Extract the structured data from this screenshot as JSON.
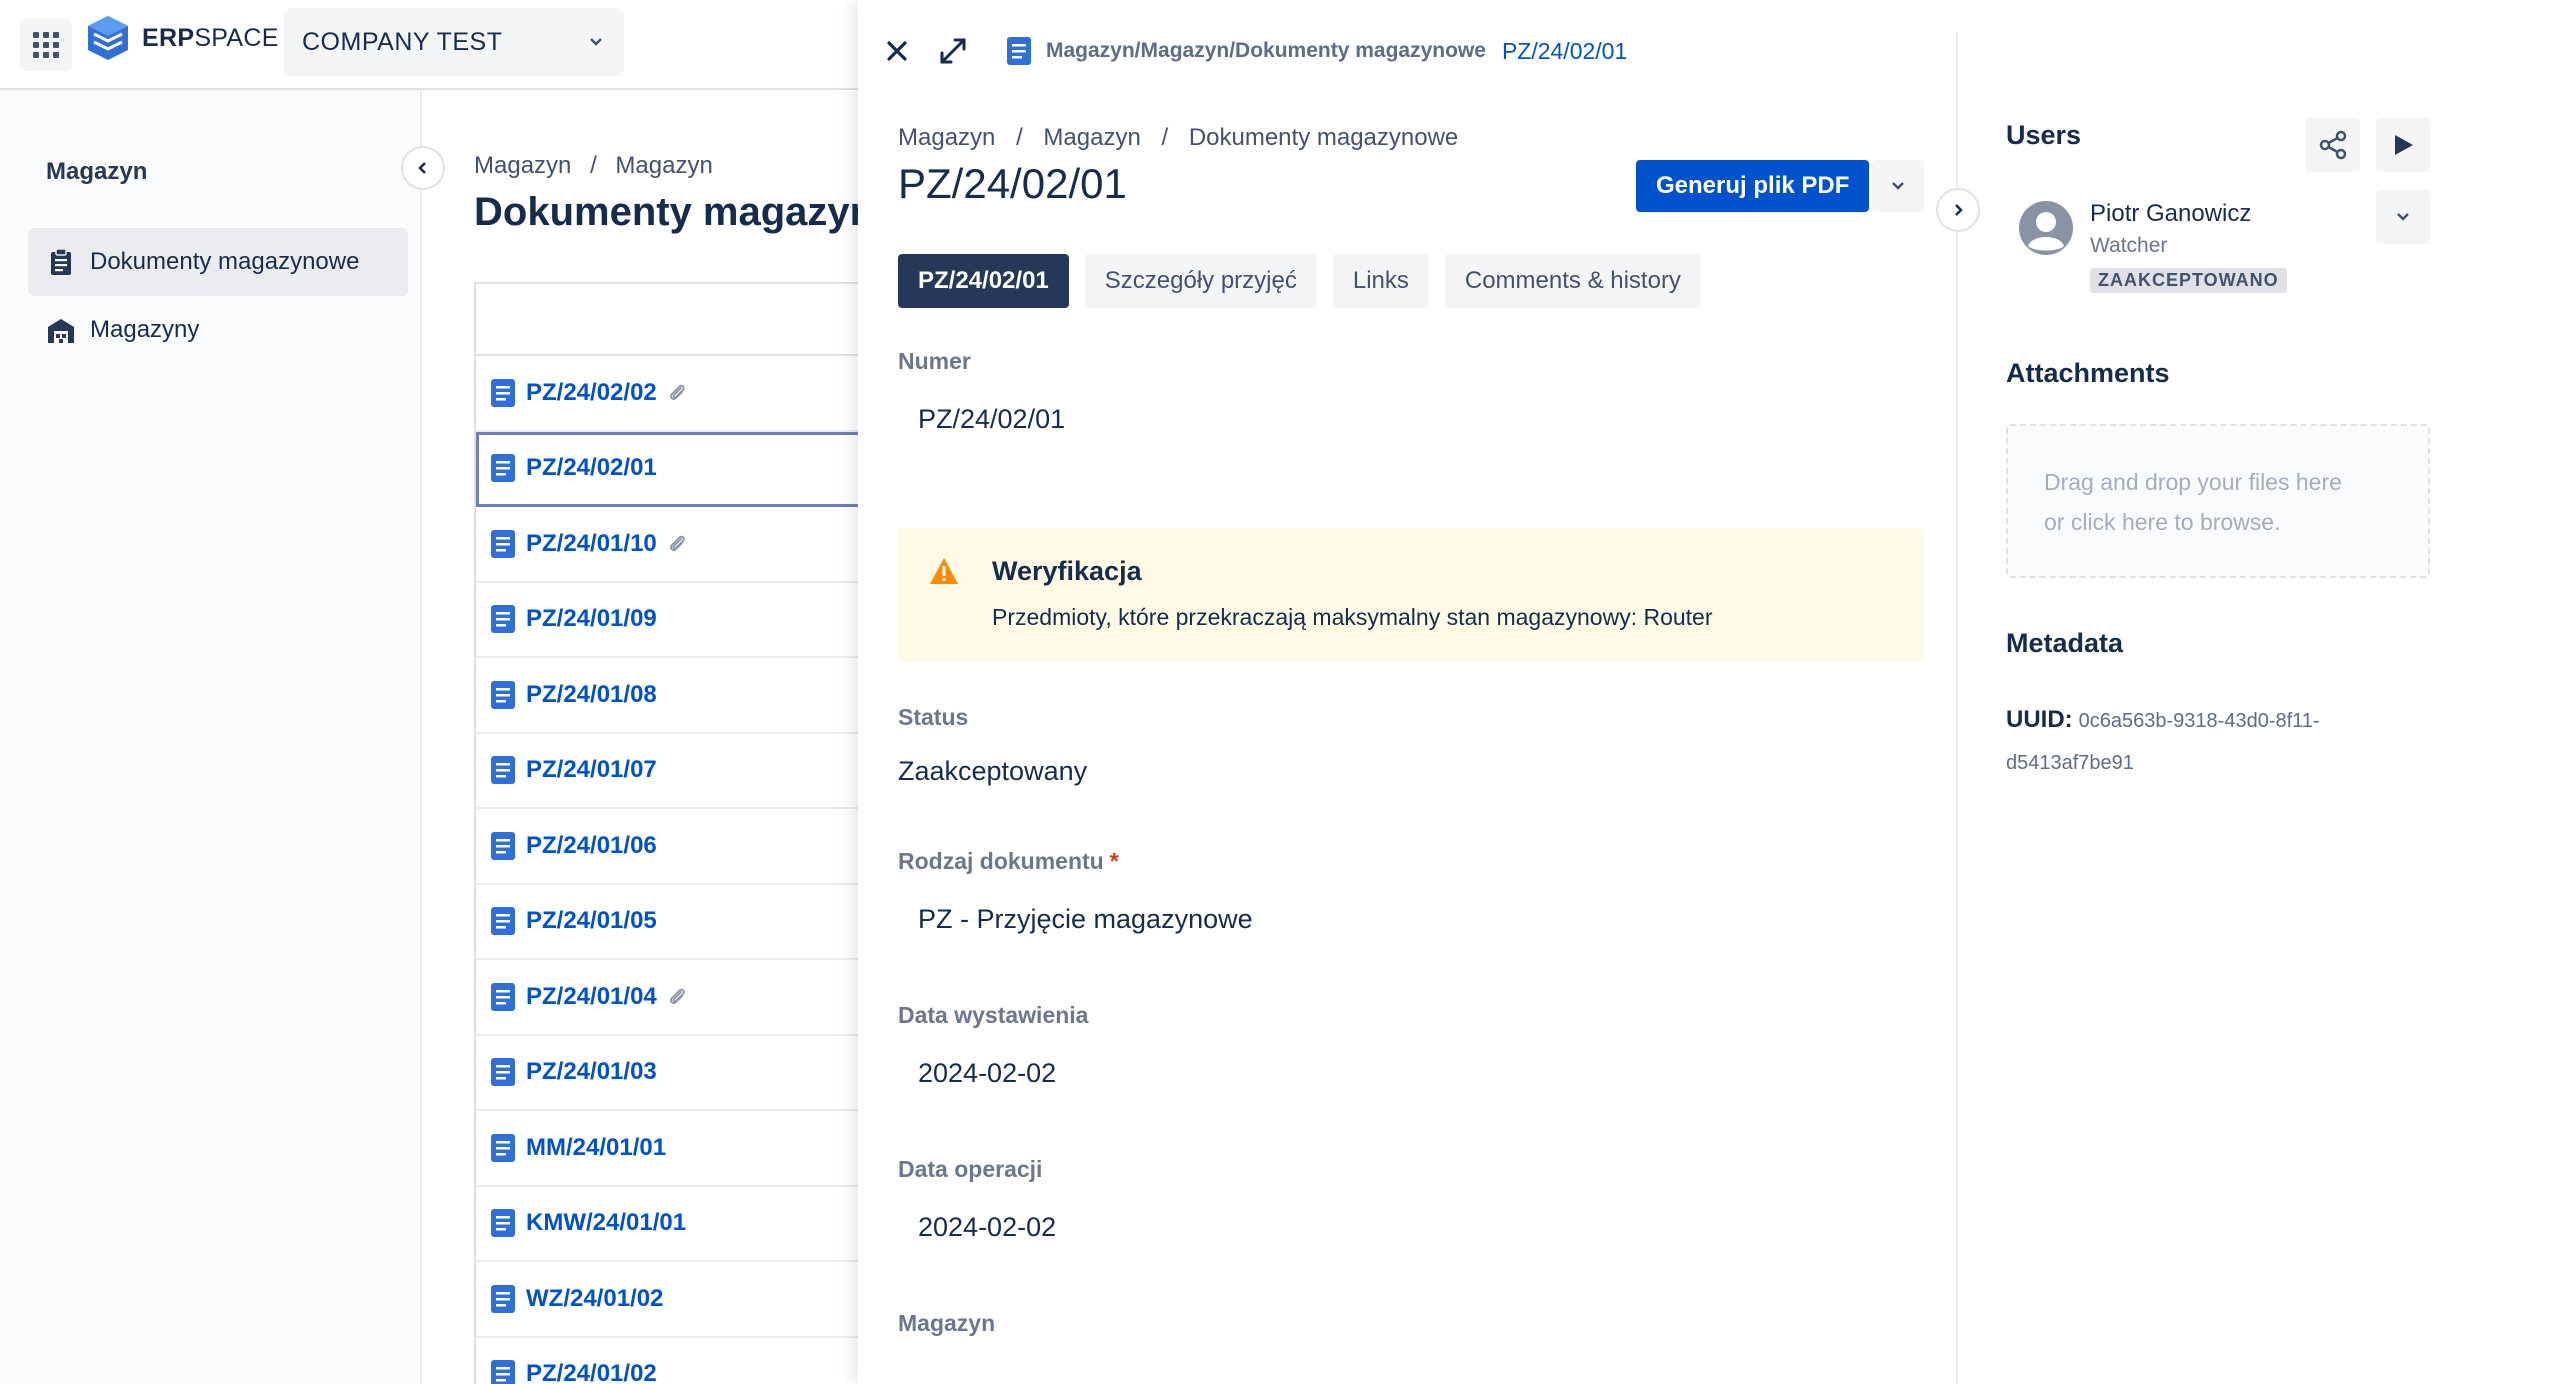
{
  "app": {
    "brand_bold": "ERP",
    "brand_light": "SPACE",
    "company": "COMPANY TEST"
  },
  "sidebar": {
    "title": "Magazyn",
    "items": [
      {
        "label": "Dokumenty magazynowe",
        "icon": "clipboard-icon",
        "active": true
      },
      {
        "label": "Magazyny",
        "icon": "warehouse-icon",
        "active": false
      }
    ]
  },
  "main": {
    "breadcrumb": [
      "Magazyn",
      "Magazyn"
    ],
    "title": "Dokumenty magazynowe",
    "rows": [
      {
        "label": "PZ/24/02/02",
        "attachment": true
      },
      {
        "label": "PZ/24/02/01",
        "attachment": false,
        "selected": true
      },
      {
        "label": "PZ/24/01/10",
        "attachment": true
      },
      {
        "label": "PZ/24/01/09",
        "attachment": false
      },
      {
        "label": "PZ/24/01/08",
        "attachment": false
      },
      {
        "label": "PZ/24/01/07",
        "attachment": false
      },
      {
        "label": "PZ/24/01/06",
        "attachment": false
      },
      {
        "label": "PZ/24/01/05",
        "attachment": false
      },
      {
        "label": "PZ/24/01/04",
        "attachment": true
      },
      {
        "label": "PZ/24/01/03",
        "attachment": false
      },
      {
        "label": "MM/24/01/01",
        "attachment": false
      },
      {
        "label": "KMW/24/01/01",
        "attachment": false
      },
      {
        "label": "WZ/24/01/02",
        "attachment": false
      },
      {
        "label": "PZ/24/01/02",
        "attachment": false
      }
    ]
  },
  "panel": {
    "path": "Magazyn/Magazyn/Dokumenty magazynowe",
    "current": "PZ/24/02/01",
    "breadcrumb": [
      "Magazyn",
      "Magazyn",
      "Dokumenty magazynowe"
    ],
    "title": "PZ/24/02/01",
    "pdf_button": "Generuj plik PDF",
    "tabs": [
      "PZ/24/02/01",
      "Szczegóły przyjęć",
      "Links",
      "Comments & history"
    ],
    "fields": {
      "numer": {
        "label": "Numer",
        "value": "PZ/24/02/01"
      },
      "status": {
        "label": "Status",
        "value": "Zaakceptowany"
      },
      "rodzaj": {
        "label": "Rodzaj dokumentu",
        "required_mark": "*",
        "value": "PZ - Przyjęcie magazynowe"
      },
      "data_wystawienia": {
        "label": "Data wystawienia",
        "value": "2024-02-02"
      },
      "data_operacji": {
        "label": "Data operacji",
        "value": "2024-02-02"
      },
      "magazyn": {
        "label": "Magazyn"
      }
    },
    "warning": {
      "title": "Weryfikacja",
      "text": "Przedmioty, które przekraczają maksymalny stan magazynowy: Router",
      "color": "#ff8b00"
    }
  },
  "right": {
    "users_title": "Users",
    "user": {
      "name": "Piotr Ganowicz",
      "role": "Watcher",
      "status": "ZAAKCEPTOWANO"
    },
    "attachments_title": "Attachments",
    "dropzone_line1": "Drag and drop your files here",
    "dropzone_line2": "or click here to browse.",
    "metadata_title": "Metadata",
    "uuid_label": "UUID:",
    "uuid_value": "0c6a563b-9318-43d0-8f11-d5413af7be91"
  },
  "colors": {
    "primary": "#0052cc",
    "dark_tab": "#253858",
    "warning_bg": "#fffae6"
  }
}
